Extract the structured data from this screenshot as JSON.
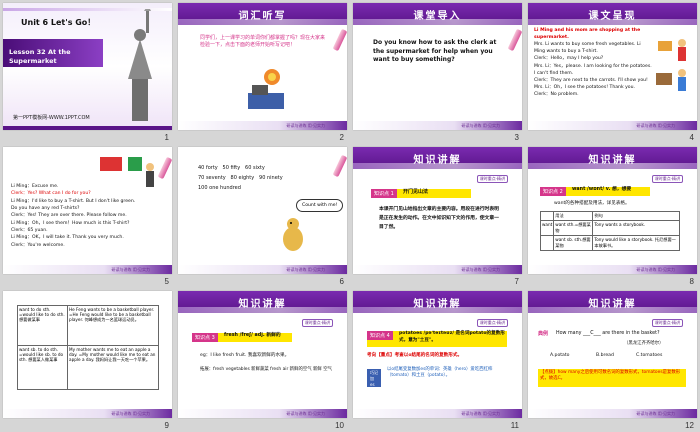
{
  "colors": {
    "accent": "#5a1489",
    "pink": "#d5358a",
    "yellow": "#ffe600",
    "red": "#d00000"
  },
  "slides": {
    "s1": {
      "num": "1",
      "unit": "Unit 6 Let's Go！",
      "lesson": "Lesson 32 At the Supermarket",
      "site": "第一PPT模板网-WWW.1PPT.COM"
    },
    "s2": {
      "num": "2",
      "title": "词汇听写",
      "text": "同学们，上一课学习的单词你们都掌握了吗？现在大家来检验一下，点击下面的老师开始听写记吧！"
    },
    "s3": {
      "num": "3",
      "title": "课堂导入",
      "text": "Do you know how to ask the clerk at the supermarket for help when you want to buy something?"
    },
    "s4": {
      "num": "4",
      "title": "课文呈现",
      "lines": [
        "Li Ming and his mom are shopping at the supermarket.",
        "Mrs. Li wants to buy some fresh vegetables. Li Ming wants to buy a T-shirt.",
        "Clerk：Hello，may I help you?",
        "Mrs. Li：Yes，please. I am looking for the potatoes. I can't find them.",
        "Clerk：They are next to the carrots. I'll show you!",
        "Mrs. Li：Oh，I see the potatoes! Thank you.",
        "Clerk：No problem."
      ]
    },
    "s5": {
      "num": "5",
      "lines": [
        "Li Ming：Excuse me.",
        "Clerk：Yes? What can I do for you?",
        "Li Ming：I'd like to buy a T-shirt. But I don't like green. Do you have any red T-shirts?",
        "Clerk：Yes! They are over there. Please follow me.",
        "Li Ming：Oh，I see them！How much is this T-shirt?",
        "Clerk：65 yuan.",
        "Li Ming：OK，I will take it. Thank you very much.",
        "Clerk：You're welcome."
      ]
    },
    "s6": {
      "num": "6",
      "numbers": [
        "40 forty",
        "50 fifty",
        "60 sixty",
        "70 seventy",
        "80 eighty",
        "90 ninety",
        "100 one hundred"
      ],
      "bubble": "Count with me!"
    },
    "s7": {
      "num": "7",
      "title": "知识讲解",
      "tag": "课时重点·精讲",
      "point": "知识点 1",
      "heading": "开门见山法",
      "text": "本课开门见山地指出文章的主要内容。用段在进行时表明是正在发生的动作。在文中如识知下文的作用，使文章一目了然。"
    },
    "s8": {
      "num": "8",
      "title": "知识讲解",
      "tag": "课时重点·精讲",
      "point": "知识点 2",
      "heading": "want /wɒnt/ v. 想，想要",
      "sub": "want的各种搭配及用法，详见表格。",
      "table": [
        [
          "",
          "用法",
          "例句"
        ],
        [
          "want",
          "want sth.=想要某物",
          "Tony wants a storybook."
        ],
        [
          "",
          "want sb. sth.想要某物",
          "Tony would like a storybook. 托尼想要一本故事书。"
        ]
      ]
    },
    "s9": {
      "num": "9",
      "table": [
        [
          "want to do sth. =would like to do sth. 想要做某事",
          "He Feng wants to be a basketball player. =He Feng would like to be a basketball player. 何峰想成为一名篮球运动员。"
        ],
        [
          "want sb. to do sth. =would like sb. to do sth. 想要某人做某事",
          "My mother wants me to eat an apple a day. =My mother would like me to eat an apple a day. 我妈妈让我一天吃一个苹果。"
        ]
      ]
    },
    "s10": {
      "num": "10",
      "title": "知识讲解",
      "tag": "课时重点·精讲",
      "point": "知识点 3",
      "heading": "fresh /freʃ/ adj. 新鲜的",
      "eg": "eg：I like fresh fruit. 我喜欢新鲜的水果。",
      "ext": "拓展：fresh vegetables 新鲜蔬菜 fresh air 新鲜的空气 新鲜 空气"
    },
    "s11": {
      "num": "11",
      "title": "知识讲解",
      "tag": "课时重点·精讲",
      "point": "知识点 4",
      "heading": "potatoes /pəˈteɪtəʊz/ 是名词potato的复数形式，意为\"土豆\"。",
      "exam": "考向【重点】考查以o结尾的名词的复数形式。",
      "memo": "以o结尾变复数加es的单词：英雄（hero）爱吃西红柿（tomato）和土豆（potato）。",
      "memo_tag": "巧记加es"
    },
    "s12": {
      "num": "12",
      "title": "知识讲解",
      "tag": "课时重点·精讲",
      "label": "典例",
      "question": "How many ___C___ are there in the basket?",
      "source": "（黑龙江齐齐哈尔）",
      "options": [
        "A.potato",
        "B.bread",
        "C.tomatoes"
      ],
      "answer": "【点拨】how many之后使用可数名词的复数形式，tomatoes是复数形式，故选C。"
    }
  },
  "footer": "研读与讲练  用·见实力"
}
